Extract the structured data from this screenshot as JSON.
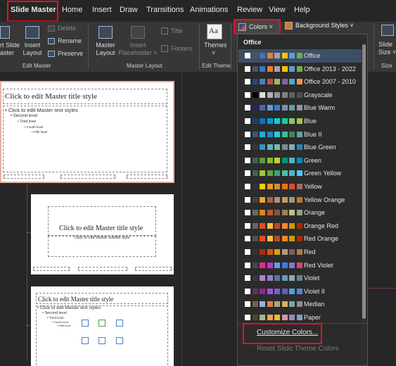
{
  "menu": {
    "items": [
      "Slide Master",
      "Home",
      "Insert",
      "Draw",
      "Transitions",
      "Animations",
      "Review",
      "View",
      "Help"
    ]
  },
  "ribbon": {
    "insert_slide_master": "rt Slide\naster",
    "insert_layout": "Insert\nLayout",
    "delete": "Delete",
    "rename": "Rename",
    "preserve": "Preserve",
    "group_edit_master": "Edit Master",
    "master_layout": "Master\nLayout",
    "insert_placeholder": "Insert\nPlaceholder ˅",
    "title": "Title",
    "footers": "Footers",
    "group_master_layout": "Master Layout",
    "themes": "Themes",
    "themes_caret": "˅",
    "group_edit_theme": "Edit Theme",
    "colors": "Colors ˅",
    "background_styles": "Background Styles ˅",
    "slide_size": "Slide\nSize ˅",
    "group_size": "Size"
  },
  "thumbnails": {
    "master_title": "Click to edit Master title style",
    "master_text": "• Click to edit Master text styles",
    "level2": "• Second level",
    "level3": "• Third level",
    "level4": "• Fourth level",
    "level5": "• Fifth level",
    "subtitle": "Click to edit Master subtitle style"
  },
  "dropdown": {
    "header": "Office",
    "customize": "Customize Colors...",
    "reset": "Reset Slide Theme Colors",
    "themes": [
      {
        "name": "Office",
        "colors": [
          "#ffffff",
          "#44546a",
          "#4472c4",
          "#ed7d31",
          "#a5a5a5",
          "#ffc000",
          "#5b9bd5",
          "#70ad47"
        ]
      },
      {
        "name": "Office 2013 - 2022",
        "colors": [
          "#ffffff",
          "#44546a",
          "#4472c4",
          "#ed7d31",
          "#a5a5a5",
          "#ffc000",
          "#5b9bd5",
          "#70ad47"
        ]
      },
      {
        "name": "Office 2007 - 2010",
        "colors": [
          "#ffffff",
          "#1f497d",
          "#4f81bd",
          "#c0504d",
          "#9bbb59",
          "#8064a2",
          "#4bacc6",
          "#f79646"
        ]
      },
      {
        "name": "Grayscale",
        "colors": [
          "#ffffff",
          "#000000",
          "#dddddd",
          "#b2b2b2",
          "#969696",
          "#808080",
          "#5f5f5f",
          "#4d4d4d"
        ]
      },
      {
        "name": "Blue Warm",
        "colors": [
          "#ffffff",
          "#242852",
          "#4a66ac",
          "#629dd1",
          "#297fd5",
          "#7f8fa9",
          "#5aa2ae",
          "#9d90a0"
        ]
      },
      {
        "name": "Blue",
        "colors": [
          "#ffffff",
          "#17406d",
          "#0f6fc6",
          "#009dd9",
          "#0bd0d9",
          "#10cf9b",
          "#7cca62",
          "#a5c249"
        ]
      },
      {
        "name": "Blue II",
        "colors": [
          "#ffffff",
          "#335b74",
          "#1cade4",
          "#2683c6",
          "#27ced7",
          "#42ba97",
          "#3e8853",
          "#62a39f"
        ]
      },
      {
        "name": "Blue Green",
        "colors": [
          "#ffffff",
          "#373545",
          "#3494ba",
          "#58b6c0",
          "#75bda7",
          "#7a8c8e",
          "#84acb6",
          "#2683c6"
        ]
      },
      {
        "name": "Green",
        "colors": [
          "#ffffff",
          "#455f51",
          "#549e39",
          "#8ab833",
          "#c0cf3a",
          "#029676",
          "#4ab5c4",
          "#0989b1"
        ]
      },
      {
        "name": "Green Yellow",
        "colors": [
          "#ffffff",
          "#455f51",
          "#99cb38",
          "#63a537",
          "#37a76f",
          "#44c1a3",
          "#4eb3cf",
          "#51c3f9"
        ]
      },
      {
        "name": "Yellow",
        "colors": [
          "#ffffff",
          "#39302a",
          "#ffca08",
          "#f8931d",
          "#ce8d3e",
          "#ec7016",
          "#e64823",
          "#9c6a6a"
        ]
      },
      {
        "name": "Yellow Orange",
        "colors": [
          "#ffffff",
          "#4e3b30",
          "#f0a22e",
          "#a5644e",
          "#b58b80",
          "#c3986d",
          "#a19574",
          "#c17529"
        ]
      },
      {
        "name": "Orange",
        "colors": [
          "#ffffff",
          "#637052",
          "#e48312",
          "#bd582c",
          "#865640",
          "#9b8357",
          "#c2bc80",
          "#94a088"
        ]
      },
      {
        "name": "Orange Red",
        "colors": [
          "#ffffff",
          "#696464",
          "#e84c22",
          "#ffbd47",
          "#b64926",
          "#ff8427",
          "#cc9900",
          "#b22600"
        ]
      },
      {
        "name": "Red Orange",
        "colors": [
          "#ffffff",
          "#505046",
          "#e84c22",
          "#ffbd47",
          "#b64926",
          "#ff8427",
          "#cc9900",
          "#b22600"
        ]
      },
      {
        "name": "Red",
        "colors": [
          "#ffffff",
          "#323232",
          "#a5300f",
          "#d55816",
          "#e19825",
          "#b19c7d",
          "#7f5f52",
          "#b27d49"
        ]
      },
      {
        "name": "Red Violet",
        "colors": [
          "#ffffff",
          "#454551",
          "#e32d91",
          "#c830cc",
          "#4ea6dc",
          "#4775e7",
          "#8971e1",
          "#d54773"
        ]
      },
      {
        "name": "Violet",
        "colors": [
          "#ffffff",
          "#373545",
          "#ad84c6",
          "#8784c7",
          "#5d739a",
          "#6997af",
          "#84acb6",
          "#6f8183"
        ]
      },
      {
        "name": "Violet II",
        "colors": [
          "#ffffff",
          "#632e62",
          "#92278f",
          "#9b57d3",
          "#755dd9",
          "#665eb8",
          "#45a5ed",
          "#5982db"
        ]
      },
      {
        "name": "Median",
        "colors": [
          "#ffffff",
          "#775f55",
          "#94b6d2",
          "#dd8047",
          "#a5ab81",
          "#d8b25c",
          "#7ba79d",
          "#968c8c"
        ]
      },
      {
        "name": "Paper",
        "colors": [
          "#ffffff",
          "#444d26",
          "#a5b592",
          "#f3a447",
          "#e7bc29",
          "#d092a7",
          "#9c85c0",
          "#809ec2"
        ]
      }
    ]
  }
}
